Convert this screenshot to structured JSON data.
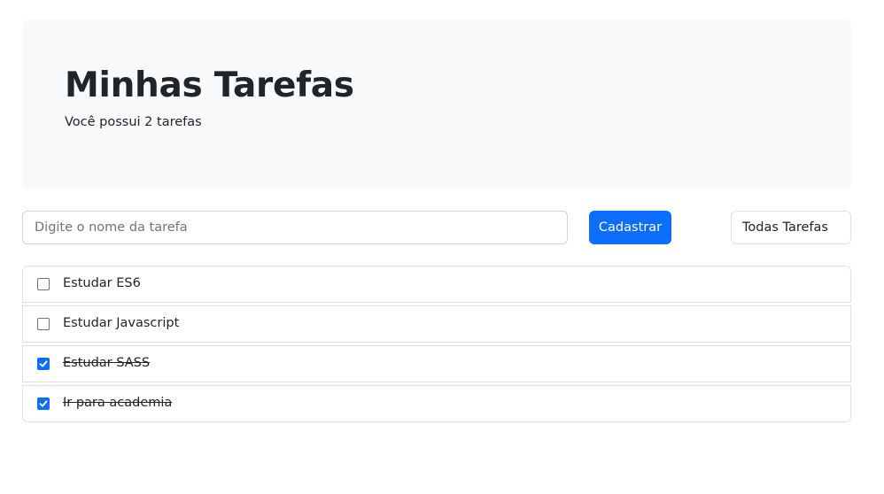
{
  "header": {
    "title": "Minhas Tarefas",
    "subtitle": "Você possui 2 tarefas"
  },
  "form": {
    "input_placeholder": "Digite o nome da tarefa",
    "input_value": "",
    "add_label": "Cadastrar",
    "filter_selected": "Todas Tarefas"
  },
  "tasks": [
    {
      "label": "Estudar ES6",
      "done": false
    },
    {
      "label": "Estudar Javascript",
      "done": false
    },
    {
      "label": "Estudar SASS",
      "done": true
    },
    {
      "label": "Ir para academia",
      "done": true
    }
  ],
  "colors": {
    "primary": "#0d6efd",
    "jumbotron_bg": "#f8f9fa",
    "border": "#dee2e6",
    "text": "#212529"
  }
}
